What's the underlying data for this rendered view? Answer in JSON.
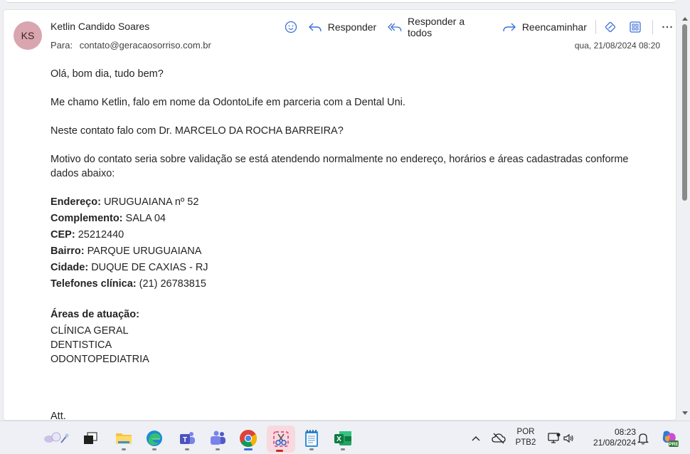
{
  "email": {
    "avatar_initials": "KS",
    "avatar_color": "#d9a5ae",
    "sender": "Ketlin Candido Soares",
    "to_label": "Para:",
    "to_address": "contato@geracaosorriso.com.br",
    "date": "qua, 21/08/2024 08:20"
  },
  "toolbar": {
    "reply": "Responder",
    "reply_all": "Responder a todos",
    "forward": "Reencaminhar",
    "accent_color": "#3b6fd8"
  },
  "message": {
    "greeting": "Olá, bom dia, tudo bem?",
    "intro": "Me chamo Ketlin, falo em nome da OdontoLife em parceria com a Dental Uni.",
    "question": "Neste contato falo com Dr. MARCELO DA ROCHA BARREIRA?",
    "motive": "Motivo do contato seria sobre validação se está atendendo normalmente no endereço, horários e áreas cadastradas conforme dados abaixo:",
    "details": [
      {
        "label": "Endereço:",
        "value": "URUGUAIANA nº 52"
      },
      {
        "label": "Complemento:",
        "value": "SALA 04"
      },
      {
        "label": "CEP:",
        "value": "25212440"
      },
      {
        "label": "Bairro:",
        "value": "PARQUE URUGUAIANA"
      },
      {
        "label": "Cidade:",
        "value": "DUQUE DE CAXIAS - RJ"
      },
      {
        "label": "Telefones clínica:",
        "value": "(21) 26783815"
      }
    ],
    "areas_title": "Áreas de atuação:",
    "areas": [
      "CLÍNICA GERAL",
      "DENTISTICA",
      "ODONTOPEDIATRIA"
    ],
    "signoff": "Att."
  },
  "taskbar": {
    "apps": [
      "widgets-icon",
      "task-view-icon",
      "file-explorer-icon",
      "edge-icon",
      "teams-icon",
      "teams-classic-icon",
      "chrome-icon",
      "snipping-tool-icon",
      "notepad-icon",
      "excel-icon"
    ],
    "language": "POR",
    "layout": "PTB2",
    "time": "08:23",
    "date": "21/08/2024",
    "copilot_badge": "PRE"
  }
}
